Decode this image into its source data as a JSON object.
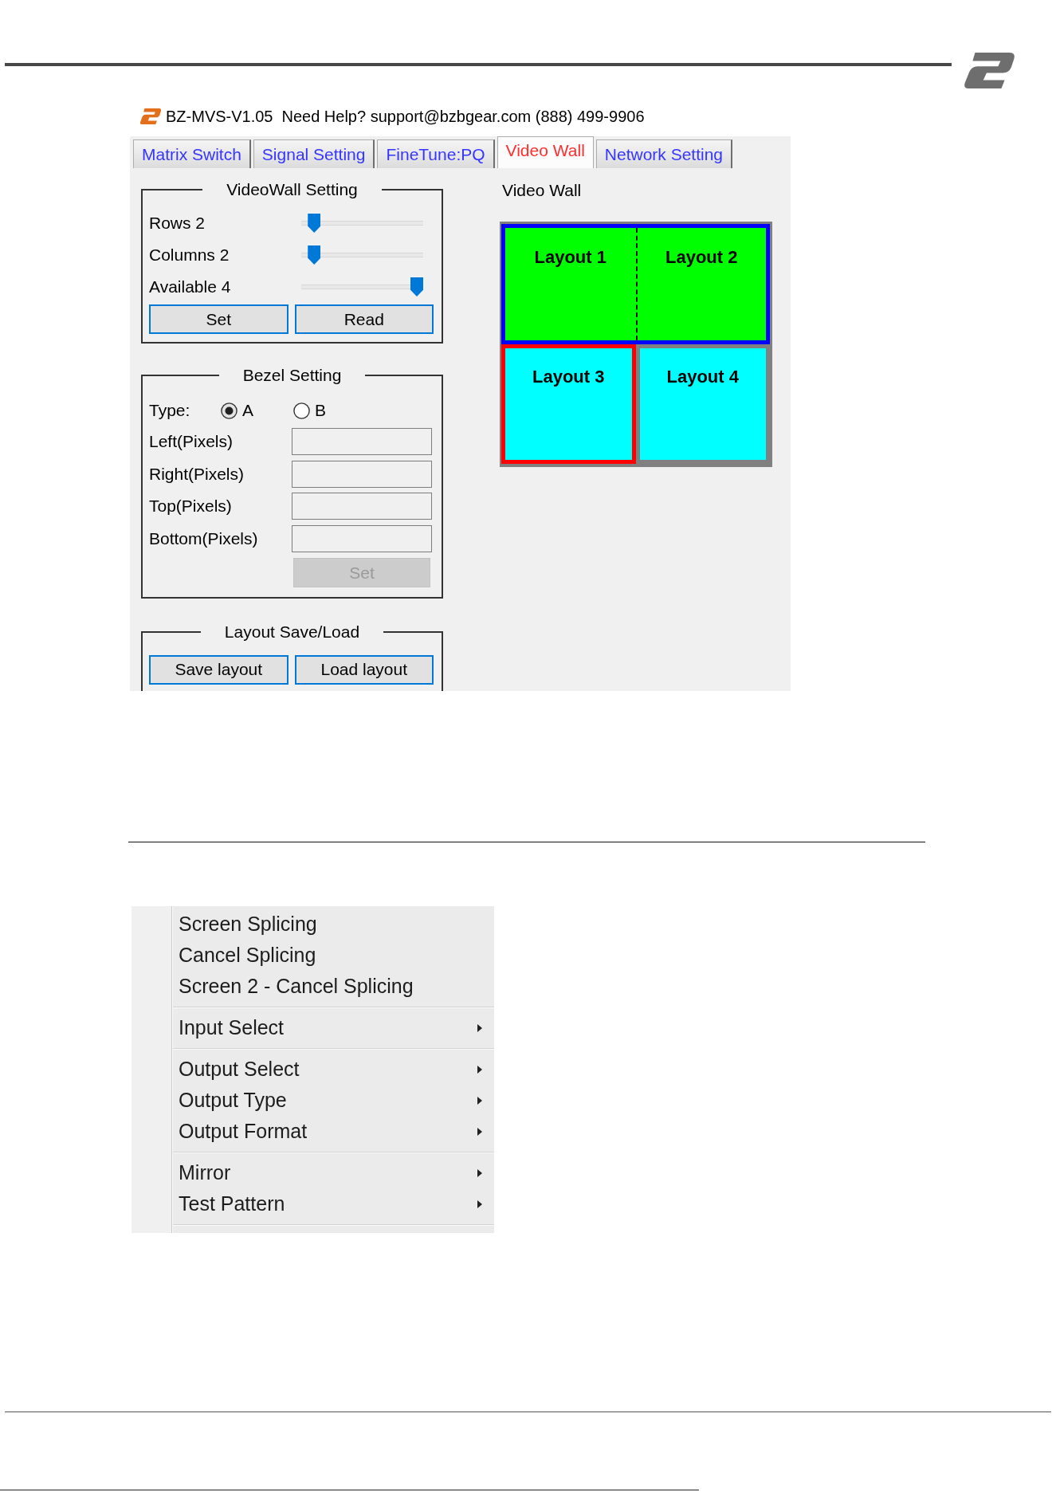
{
  "app": {
    "title": "BZ-MVS-V1.05",
    "help": "Need Help? support@bzbgear.com (888) 499-9906",
    "tabs": [
      {
        "label": "Matrix Switch",
        "selected": false
      },
      {
        "label": "Signal Setting",
        "selected": false
      },
      {
        "label": "FineTune:PQ",
        "selected": false
      },
      {
        "label": "Video Wall",
        "selected": true
      },
      {
        "label": "Network Setting",
        "selected": false
      }
    ],
    "videowall_setting": {
      "title": "VideoWall Setting",
      "sliders": [
        {
          "label": "Rows 2",
          "level": 0.06
        },
        {
          "label": "Columns 2",
          "level": 0.06
        },
        {
          "label": "Available 4",
          "level": 1
        }
      ],
      "buttons": [
        {
          "label": "Set",
          "disabled": false
        },
        {
          "label": "Read",
          "disabled": false
        }
      ]
    },
    "bezel_setting": {
      "title": "Bezel Setting",
      "type_label": "Type:",
      "type_options": [
        {
          "label": "A",
          "selected": true
        },
        {
          "label": "B",
          "selected": false
        }
      ],
      "fields": [
        {
          "label": "Left(Pixels)"
        },
        {
          "label": "Right(Pixels)"
        },
        {
          "label": "Top(Pixels)"
        },
        {
          "label": "Bottom(Pixels)"
        }
      ],
      "button": {
        "label": "Set",
        "disabled": true
      }
    },
    "layout_save_load": {
      "title": "Layout Save/Load",
      "buttons": [
        {
          "label": "Save layout",
          "disabled": false
        },
        {
          "label": "Load layout",
          "disabled": false
        }
      ]
    },
    "video_wall": {
      "title": "Video Wall",
      "rows": [
        {
          "spliced": true,
          "tiles": [
            {
              "label": "Layout 1",
              "color": "#00ff00",
              "selected": false
            },
            {
              "label": "Layout 2",
              "color": "#00ff00",
              "selected": false
            }
          ]
        },
        {
          "spliced": false,
          "tiles": [
            {
              "label": "Layout 3",
              "color": "#00ffff",
              "selected": true
            },
            {
              "label": "Layout 4",
              "color": "#00ffff",
              "selected": false
            }
          ]
        }
      ]
    }
  },
  "context_menu": {
    "groups": [
      {
        "items": [
          {
            "label": "Screen Splicing",
            "submenu": false
          },
          {
            "label": "Cancel Splicing",
            "submenu": false
          },
          {
            "label": "Screen 2 - Cancel Splicing",
            "submenu": false
          }
        ]
      },
      {
        "items": [
          {
            "label": "Input Select",
            "submenu": true
          }
        ]
      },
      {
        "items": [
          {
            "label": "Output Select",
            "submenu": true
          },
          {
            "label": "Output Type",
            "submenu": true
          },
          {
            "label": "Output Format",
            "submenu": true
          }
        ]
      },
      {
        "items": [
          {
            "label": "Mirror",
            "submenu": true
          },
          {
            "label": "Test Pattern",
            "submenu": true
          }
        ]
      }
    ]
  }
}
